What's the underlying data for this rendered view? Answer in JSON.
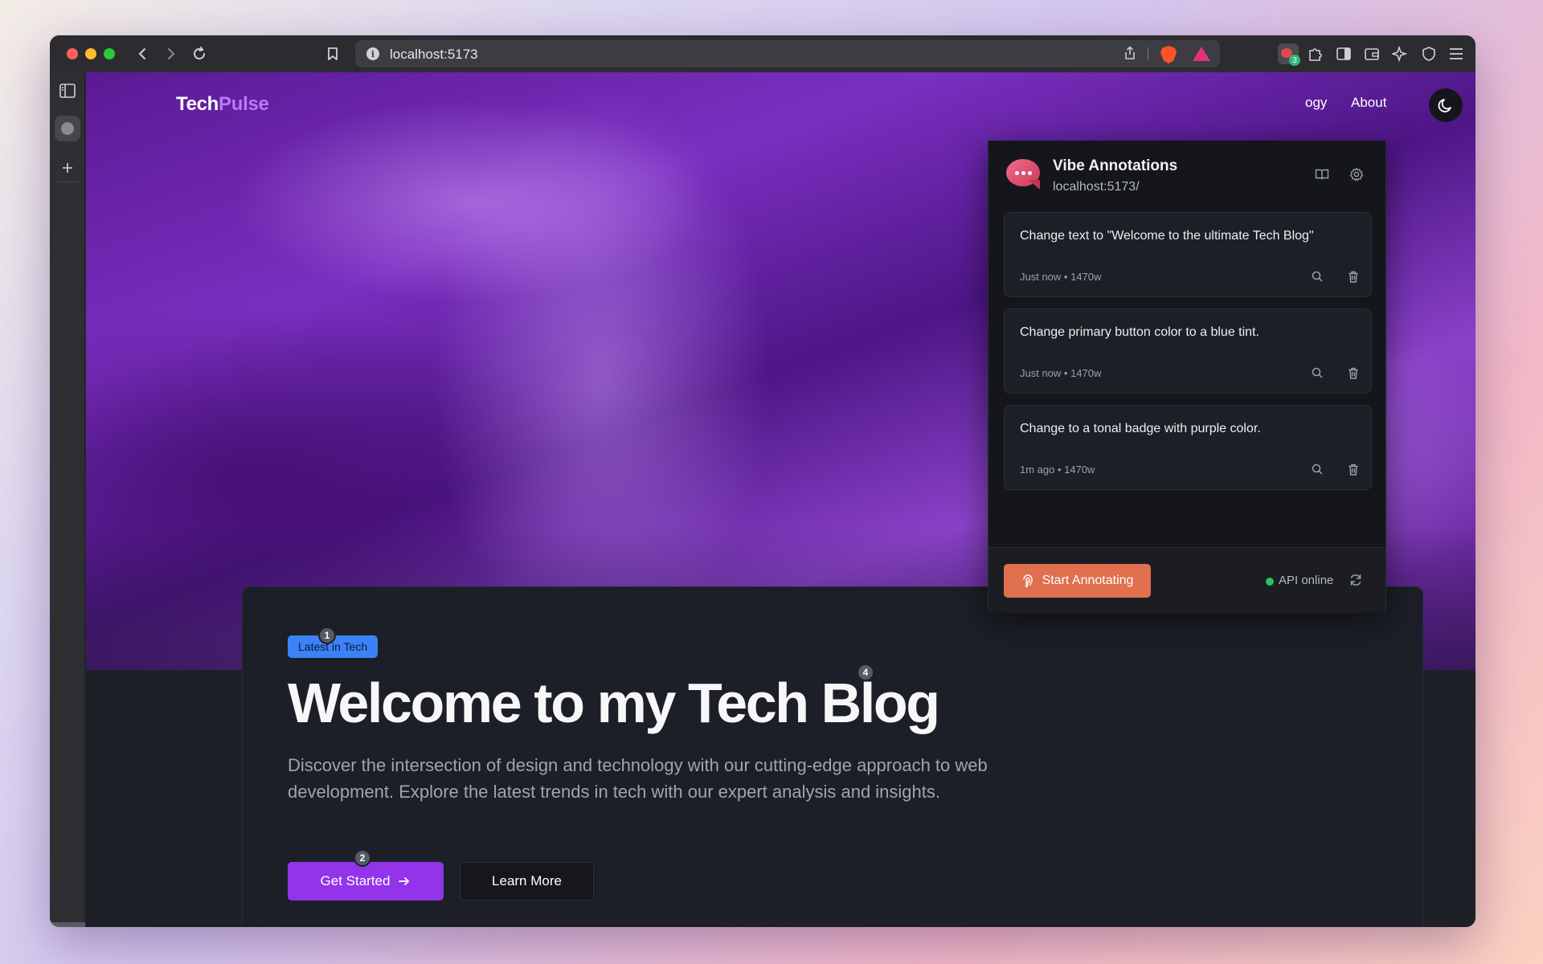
{
  "browser": {
    "url": "localhost:5173",
    "extension_badge_count": "3"
  },
  "site": {
    "logo_main": "Tech",
    "logo_accent": "Pulse",
    "nav_partial": "ogy",
    "nav_about": "About"
  },
  "hero_card": {
    "badge": "Latest in Tech",
    "headline": "Welcome to my Tech Blog",
    "subtext": "Discover the intersection of design and technology with our cutting-edge approach to web development. Explore the latest trends in tech with our expert analysis and insights.",
    "primary_button": "Get Started",
    "secondary_button": "Learn More",
    "markers": [
      "1",
      "4",
      "2"
    ]
  },
  "panel": {
    "title": "Vibe Annotations",
    "url": "localhost:5173/",
    "annotations": [
      {
        "text": "Change text to \"Welcome to the ultimate Tech Blog\"",
        "meta": "Just now • 1470w"
      },
      {
        "text": "Change primary button color to a blue tint.",
        "meta": "Just now • 1470w"
      },
      {
        "text": "Change to a tonal badge with purple color.",
        "meta": "1m ago • 1470w"
      }
    ],
    "start_button": "Start Annotating",
    "api_status": "API online"
  },
  "colors": {
    "accent_purple": "#9333ea",
    "logo_accent": "#b67cf7",
    "badge_blue": "#3b82f6",
    "start_orange": "#e0704e",
    "api_green": "#22c55e"
  }
}
